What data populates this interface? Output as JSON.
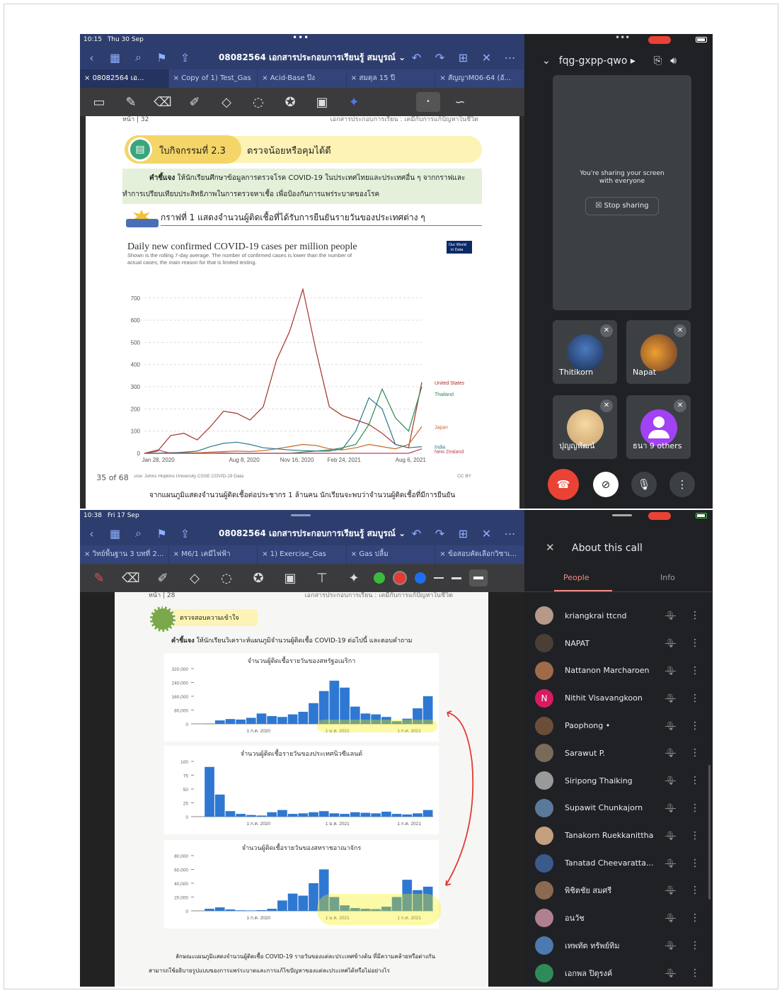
{
  "screen1": {
    "status": {
      "time": "10:15",
      "date": "Thu 30 Sep"
    },
    "doc_title": "08082564 เอกสารประกอบการเรียนรู้ สมบูรณ์ ⌄",
    "tabs": [
      "08082564 เอ...",
      "Copy of 1) Test_Gas",
      "Acid-Base ป๊ง",
      "สมดุล 15 ปี",
      "สัญญาM06-64 (อั..."
    ],
    "page_header": {
      "left": "หน้า | 32",
      "right": "เอกสารประกอบการเรียน : เคมีกับการแก้ปัญหาในชีวิต"
    },
    "activity": {
      "label": "ใบกิจกรรมที่ 2.3",
      "title": "ตรวจน้อยหรือคุมได้ดี"
    },
    "instruction_bold": "คำชี้แจง",
    "instruction_text": "ให้นักเรียนศึกษาข้อมูลการตรวจโรค COVID-19 ในประเทศไทยและประเทศอื่น ๆ จากกราฟและ",
    "instruction_text2": "ทำการเปรียบเทียบประสิทธิภาพในการตรวจหาเชื้อ เพื่อป้องกันการแพร่ระบาดของโรค",
    "graph_heading": "กราฟที่ 1 แสดงจำนวนผู้ติดเชื้อที่ได้รับการยืนยันรายวันของประเทศต่าง ๆ",
    "page_counter": "35 of 68",
    "bottom_text": "จากแผนภูมิแสดงจำนวนผู้ติดเชื้อต่อประชากร 1 ล้านคน นักเรียนจะพบว่าจำนวนผู้ติดเชื้อที่มีการยืนยัน"
  },
  "meet1": {
    "code": "fqg-gxpp-qwo ▸",
    "sharing_line1": "You're sharing your screen",
    "sharing_line2": "with everyone",
    "stop_sharing": "Stop sharing",
    "tiles": [
      "Thitikorn",
      "Napat",
      "ปุญญพัฒน์",
      "ธนา  9 others"
    ]
  },
  "screen2": {
    "status": {
      "time": "10:38",
      "date": "Fri 17 Sep"
    },
    "doc_title": "08082564 เอกสารประกอบการเรียนรู้ สมบูรณ์ ⌄",
    "tabs": [
      "วิทย์พื้นฐาน 3 บทที่ 2...",
      "M6/1 เคมีไฟฟ้า",
      "1) Exercise_Gas",
      "Gas ปลื้ม",
      "ข้อสอบคัดเลือกวิชาเ..."
    ],
    "page_header": {
      "left": "หน้า | 28",
      "right": "เอกสารประกอบการเรียน : เคมีกับการแก้ปัญหาในชีวิต"
    },
    "badge": "ตรวจสอบความเข้าใจ",
    "instruction_bold": "คำชี้แจง",
    "instruction_text": "ให้นักเรียนวิเคราะห์แผนภูมิจำนวนผู้ติดเชื้อ COVID-19 ต่อไปนี้ และตอบคำถาม",
    "footer1": "ลักษณะแผนภูมิแสดงจำนวนผู้ติดเชื้อ COVID-19 รายวันของแต่ละประเทศข้างต้น ที่มีความคล้ายหรือต่างกัน",
    "footer2": "สามารถใช้อธิบายรูปแบบของการแพร่ระบาดและการแก้ไขปัญหาของแต่ละประเทศได้หรือไม่อย่างไร"
  },
  "meet2": {
    "title": "About this call",
    "tab_people": "People",
    "tab_info": "Info",
    "people": [
      {
        "name": "kriangkrai ttcnd",
        "color": "#b59a8a"
      },
      {
        "name": "NAPAT",
        "color": "#4a3f35"
      },
      {
        "name": "Nattanon Marcharoen",
        "color": "#a06a4a"
      },
      {
        "name": "Nithit Visavangkoon",
        "color": "#d81b60",
        "initial": "N"
      },
      {
        "name": "Paophong •",
        "color": "#6b4e3a"
      },
      {
        "name": "Sarawut P.",
        "color": "#7a6a5a"
      },
      {
        "name": "Siripong Thaiking",
        "color": "#9a9a9a"
      },
      {
        "name": "Supawit Chunkajorn",
        "color": "#5a7a9a"
      },
      {
        "name": "Tanakorn Ruekkanittha",
        "color": "#c4a080"
      },
      {
        "name": "Tanatad Cheevaratta...",
        "color": "#3a5a8a"
      },
      {
        "name": "พิชิตชัย สมศรี",
        "color": "#8a6a50"
      },
      {
        "name": "อนวัช",
        "color": "#b08090"
      },
      {
        "name": "เทพทัต ทรัพย์ทิม",
        "color": "#4a7ab0"
      },
      {
        "name": "เอกพล ปิตุรงค์",
        "color": "#2e8b57"
      }
    ]
  },
  "chart_data": [
    {
      "type": "line",
      "title": "Daily new confirmed COVID-19 cases per million people",
      "subtitle": "Shown is the rolling 7-day average. The number of confirmed cases is lower than the number of actual cases; the main reason for that is limited testing.",
      "badge": "Our World in Data",
      "source": "Source: Johns Hopkins University CSSE COVID-19 Data",
      "license": "CC BY",
      "x_ticks": [
        "Jan 28, 2020",
        "Aug 8, 2020",
        "Nov 16, 2020",
        "Feb 24, 2021",
        "Aug 6, 2021"
      ],
      "y_ticks": [
        0,
        100,
        200,
        300,
        400,
        500,
        600,
        700
      ],
      "ylim": [
        0,
        760
      ],
      "x": [
        0,
        30,
        60,
        90,
        120,
        150,
        180,
        210,
        240,
        270,
        300,
        330,
        360,
        390,
        420,
        450,
        480,
        510,
        540,
        570,
        600,
        630
      ],
      "series": [
        {
          "name": "United States",
          "color": "#a2322a",
          "values": [
            0,
            10,
            80,
            90,
            60,
            120,
            190,
            180,
            150,
            210,
            420,
            550,
            740,
            460,
            210,
            170,
            150,
            130,
            90,
            40,
            25,
            320
          ]
        },
        {
          "name": "Thailand",
          "color": "#2e8a4e",
          "values": [
            0,
            0,
            0,
            0,
            0,
            0,
            0,
            0,
            0,
            0,
            0,
            0,
            5,
            10,
            15,
            25,
            40,
            130,
            290,
            160,
            100,
            300
          ]
        },
        {
          "name": "Japan",
          "color": "#c46a2a",
          "values": [
            0,
            0,
            3,
            2,
            2,
            5,
            8,
            10,
            8,
            12,
            20,
            30,
            40,
            35,
            20,
            15,
            25,
            40,
            30,
            20,
            40,
            120
          ]
        },
        {
          "name": "India",
          "color": "#2a7a8a",
          "values": [
            0,
            0,
            2,
            5,
            10,
            30,
            45,
            50,
            40,
            25,
            20,
            15,
            12,
            10,
            10,
            20,
            100,
            250,
            200,
            40,
            25,
            30
          ]
        },
        {
          "name": "New Zealand",
          "color": "#c0405a",
          "values": [
            0,
            15,
            0,
            0,
            0,
            0,
            2,
            0,
            0,
            0,
            0,
            0,
            0,
            0,
            0,
            0,
            0,
            0,
            0,
            0,
            0,
            20
          ]
        }
      ],
      "series_label_texts": [
        "United States",
        "Thailand",
        "Japan",
        "India",
        "New Zealand"
      ]
    },
    {
      "type": "bar",
      "title": "จำนวนผู้ติดเชื้อรายวันของสหรัฐอเมริกา",
      "y_ticks": [
        "320,000",
        "240,000",
        "160,000",
        "80,000",
        "0"
      ],
      "ylim": [
        0,
        320000
      ],
      "x_ticks": [
        "1 ก.ค. 2020",
        "1 ม.ค. 2021",
        "1 ก.ค. 2021"
      ],
      "values": [
        0,
        2000,
        20000,
        28000,
        25000,
        35000,
        60000,
        45000,
        40000,
        55000,
        70000,
        120000,
        190000,
        250000,
        210000,
        100000,
        60000,
        55000,
        40000,
        15000,
        30000,
        90000,
        160000
      ]
    },
    {
      "type": "bar",
      "title": "จำนวนผู้ติดเชื้อรายวันของประเทศนิวซีแลนด์",
      "y_ticks": [
        "100",
        "75",
        "50",
        "25",
        "0"
      ],
      "ylim": [
        0,
        100
      ],
      "x_ticks": [
        "1 ก.ค. 2020",
        "1 ม.ค. 2021",
        "1 ก.ค. 2021"
      ],
      "values": [
        0,
        90,
        40,
        10,
        5,
        3,
        2,
        8,
        12,
        5,
        6,
        8,
        10,
        6,
        5,
        8,
        7,
        6,
        9,
        5,
        4,
        6,
        12
      ]
    },
    {
      "type": "bar",
      "title": "จำนวนผู้ติดเชื้อรายวันของสหราชอาณาจักร",
      "y_ticks": [
        "80,000",
        "60,000",
        "40,000",
        "20,000",
        "0"
      ],
      "ylim": [
        0,
        80000
      ],
      "x_ticks": [
        "1 ก.ค. 2020",
        "1 ม.ค. 2021",
        "1 ก.ค. 2021"
      ],
      "values": [
        0,
        3000,
        5000,
        2000,
        800,
        600,
        1000,
        3000,
        15000,
        25000,
        22000,
        40000,
        60000,
        20000,
        8000,
        4000,
        3000,
        2500,
        6000,
        20000,
        45000,
        30000,
        35000
      ]
    }
  ]
}
